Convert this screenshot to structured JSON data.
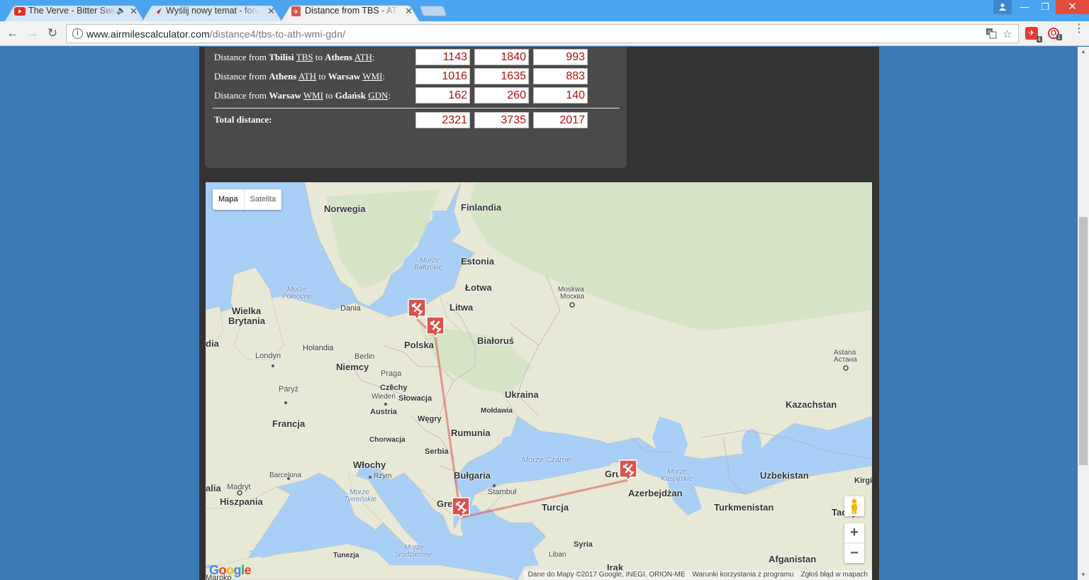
{
  "browser": {
    "tabs": [
      {
        "title": "The Verve - Bitter Swe",
        "favicon": "youtube-icon",
        "audio": true,
        "active": false
      },
      {
        "title": "Wyślij nowy temat - foru",
        "favicon": "plane-icon",
        "audio": false,
        "active": false
      },
      {
        "title": "Distance from TBS - ATH",
        "favicon": "airmiles-icon",
        "audio": false,
        "active": true
      }
    ],
    "url_host": "www.airmilescalculator.com",
    "url_path": "/distance4/tbs-to-ath-wmi-gdn/",
    "extensions": [
      {
        "name": "extension-red-icon",
        "badge": "4",
        "color": "#e53935"
      },
      {
        "name": "opera-icon",
        "badge": "1",
        "color": "#d32f2f"
      }
    ]
  },
  "distances": {
    "rows": [
      {
        "prefix": "Distance from ",
        "from_city": "Tbilisi",
        "from_code": "TBS",
        "mid": " to ",
        "to_city": "Athens",
        "to_code": "ATH",
        "miles": "1143",
        "km": "1840",
        "nm": "993"
      },
      {
        "prefix": "Distance from ",
        "from_city": "Athens",
        "from_code": "ATH",
        "mid": " to ",
        "to_city": "Warsaw",
        "to_code": "WMI",
        "miles": "1016",
        "km": "1635",
        "nm": "883"
      },
      {
        "prefix": "Distance from ",
        "from_city": "Warsaw",
        "from_code": "WMI",
        "mid": " to ",
        "to_city": "Gdańsk",
        "to_code": "GDN",
        "miles": "162",
        "km": "260",
        "nm": "140"
      }
    ],
    "total_label": "Total distance:",
    "total": {
      "miles": "2321",
      "km": "3735",
      "nm": "2017"
    }
  },
  "map": {
    "type_buttons": {
      "map": "Mapa",
      "satellite": "Satelita"
    },
    "labels": {
      "norwegia": "Norwegia",
      "finlandia": "Finlandia",
      "estonia": "Estonia",
      "morze_baltyckie_1": "Morze",
      "morze_baltyckie_2": "Bałtyckie",
      "lotwa": "Łotwa",
      "morze_polnocne_1": "Morze",
      "morze_polnocne_2": "Północne",
      "moskwa_1": "Moskwa",
      "moskwa_2": "Москва",
      "wielka_1": "Wielka",
      "wielka_2": "Brytania",
      "dania": "Dania",
      "litwa": "Litwa",
      "bialorus": "Białoruś",
      "polska": "Polska",
      "ia": "dia",
      "holandia": "Holandia",
      "berlin": "Berlin",
      "londyn": "Londyn",
      "niemcy": "Niemcy",
      "astana_1": "Astana",
      "astana_2": "Астана",
      "praga": "Praga",
      "paryz": "Paryż",
      "czechy": "Czechy",
      "wieden": "Wiedeń",
      "slowacja": "Słowacja",
      "ukraina": "Ukraina",
      "austria": "Austria",
      "moldawia": "Mołdawia",
      "kazachstan": "Kazachstan",
      "francja": "Francja",
      "wegry": "Węgry",
      "rumunia": "Rumunia",
      "chorwacja": "Chorwacja",
      "serbia": "Serbia",
      "morze_czarne": "Morze Czarne",
      "wlochy": "Włochy",
      "bulgaria": "Bułgaria",
      "gruzja": "Gruz",
      "barcelona": "Barcelona",
      "rzym": "Rzym",
      "morze_kaspijskie_1": "Morze",
      "morze_kaspijskie_2": "Kaspijskie",
      "uzbekistan": "Uzbekistan",
      "kirgi": "Kirgi",
      "alia": "alia",
      "madryt": "Madryt",
      "stambul": "Stambuł",
      "azerbejdzan": "Azerbejdżan",
      "hiszpania": "Hiszpania",
      "morze_tyrrenskie_1": "Morze",
      "morze_tyrrenskie_2": "Tyrreńskie",
      "grecja": "Gre",
      "turcja": "Turcja",
      "turkmenistan": "Turkmenistan",
      "tadzyk": "Tadżyk",
      "tunezja": "Tunezja",
      "morze_srodziemne_1": "Morze",
      "morze_srodziemne_2": "Śródziemne",
      "syria": "Syria",
      "liban": "Liban",
      "afganistan": "Afganistan",
      "irak": "Irak",
      "maroko": "Maroko"
    },
    "attribution": {
      "data": "Dane do Mapy ©2017 Google, INEGI, ORION-ME",
      "terms": "Warunki korzystania z programu",
      "report": "Zgłoś błąd w mapach"
    },
    "logo": "Google",
    "zoom_in": "+",
    "zoom_out": "−",
    "route_color": "#d9534f"
  }
}
